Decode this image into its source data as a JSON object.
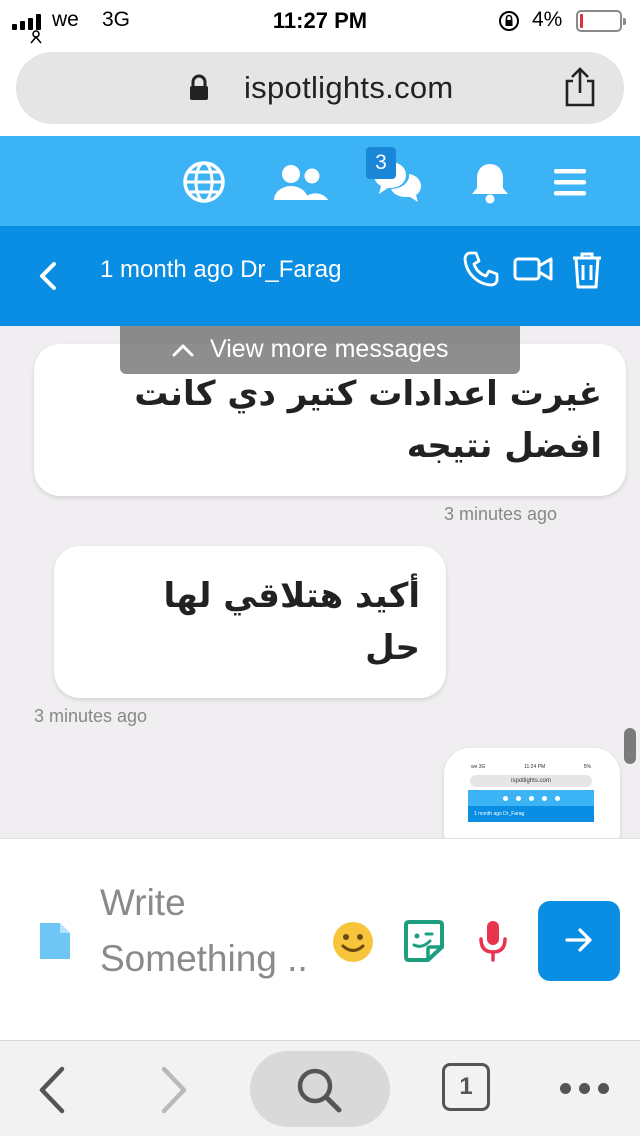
{
  "status_bar": {
    "carrier": "we",
    "network": "3G",
    "time": "11:27 PM",
    "battery_percent": "4%",
    "battery_level": 0.04,
    "battery_color": "#e0303a"
  },
  "browser": {
    "url": "ispotlights.com",
    "tab_count": "1"
  },
  "app_nav": {
    "icons": [
      "globe-icon",
      "users-icon",
      "chat-bubbles-icon",
      "bell-icon",
      "menu-icon"
    ],
    "chat_badge": "3",
    "background": "#3cb3f5"
  },
  "chat_header": {
    "title": "1 month ago Dr_Farag",
    "icons": [
      "back-chevron-icon",
      "phone-icon",
      "video-icon",
      "trash-icon"
    ],
    "background": "#0a8ee4"
  },
  "messages": {
    "view_more": "View more messages",
    "items": [
      {
        "side": "right",
        "text_line1": "غيرت اعدادات كتير دي كانت",
        "text_line2": "افضل نتيجه",
        "time": "3 minutes ago"
      },
      {
        "side": "left",
        "text_line1": "أكيد هتلاقي لها",
        "text_line2": "حل",
        "time": "3 minutes ago"
      },
      {
        "side": "right",
        "kind": "image-thumbnail"
      }
    ],
    "thumbnail": {
      "status_left": "we 3G",
      "status_time": "11:24 PM",
      "status_right": "5%",
      "url": "ispotlights.com",
      "title": "1 month ago Dr_Farag"
    }
  },
  "composer": {
    "placeholder": "Write Something ..",
    "icons": [
      "file-icon",
      "emoji-icon",
      "sticker-icon",
      "microphone-icon",
      "send-arrow-icon"
    ],
    "accent": "#0a8ee4"
  }
}
